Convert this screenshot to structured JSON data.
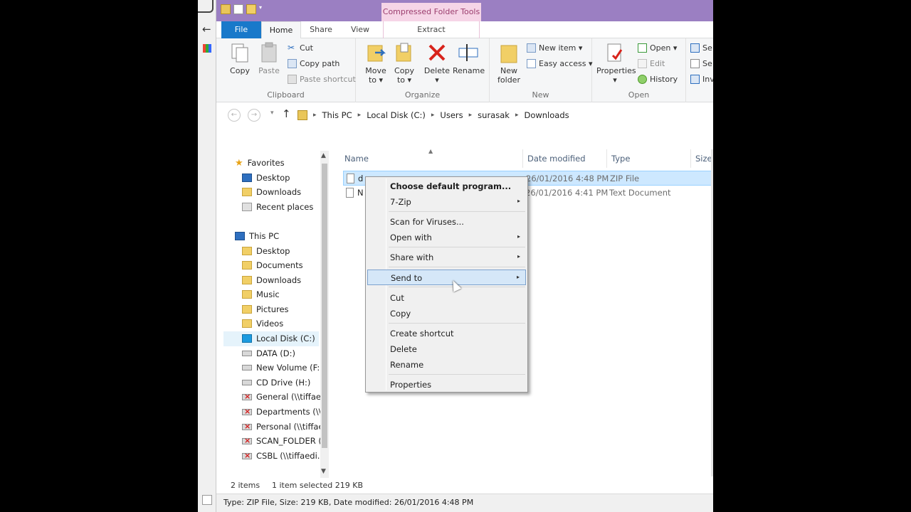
{
  "titlebar": {
    "contextual_tab_group": "Compressed Folder Tools"
  },
  "tabs": {
    "file": "File",
    "home": "Home",
    "share": "Share",
    "view": "View",
    "extract": "Extract"
  },
  "ribbon": {
    "clipboard": {
      "label": "Clipboard",
      "copy": "Copy",
      "paste": "Paste",
      "cut": "Cut",
      "copy_path": "Copy path",
      "paste_shortcut": "Paste shortcut"
    },
    "organize": {
      "label": "Organize",
      "move_to_1": "Move",
      "move_to_2": "to ▾",
      "copy_to_1": "Copy",
      "copy_to_2": "to ▾",
      "delete": "Delete",
      "delete_caret": "▾",
      "rename": "Rename"
    },
    "new": {
      "label": "New",
      "new_folder_1": "New",
      "new_folder_2": "folder",
      "new_item": "New item ▾",
      "easy_access": "Easy access ▾"
    },
    "open": {
      "label": "Open",
      "properties": "Properties",
      "properties_caret": "▾",
      "open": "Open ▾",
      "edit": "Edit",
      "history": "History"
    },
    "select": {
      "item1": "Se",
      "item2": "Se",
      "item3": "Inv"
    }
  },
  "address": {
    "crumbs": [
      "This PC",
      "Local Disk (C:)",
      "Users",
      "surasak",
      "Downloads"
    ]
  },
  "navpane": {
    "favorites": "Favorites",
    "fav_items": [
      "Desktop",
      "Downloads",
      "Recent places"
    ],
    "this_pc": "This PC",
    "pc_items": [
      "Desktop",
      "Documents",
      "Downloads",
      "Music",
      "Pictures",
      "Videos",
      "Local Disk (C:)",
      "DATA (D:)",
      "New Volume (F:)",
      "CD Drive (H:)",
      "General (\\\\tiffaed",
      "Departments (\\\\t",
      "Personal (\\\\tiffae",
      "SCAN_FOLDER (\\",
      "CSBL (\\\\tiffaedi.lo"
    ]
  },
  "filelist": {
    "columns": {
      "name": "Name",
      "date": "Date modified",
      "type": "Type",
      "size": "Size"
    },
    "rows": [
      {
        "name": "d",
        "date": "26/01/2016 4:48 PM",
        "type": "ZIP File"
      },
      {
        "name": "N",
        "date": "26/01/2016 4:41 PM",
        "type": "Text Document"
      }
    ]
  },
  "context_menu": {
    "choose_default": "Choose default program...",
    "seven_zip": "7-Zip",
    "scan": "Scan for Viruses...",
    "open_with": "Open with",
    "share_with": "Share with",
    "send_to": "Send to",
    "cut": "Cut",
    "copy": "Copy",
    "create_shortcut": "Create shortcut",
    "delete": "Delete",
    "rename": "Rename",
    "properties": "Properties",
    "submenu_arrow": "▸"
  },
  "status": {
    "items": "2 items",
    "selected": "1 item selected  219 KB"
  },
  "infobar": {
    "text": "Type: ZIP File, Size: 219 KB, Date modified: 26/01/2016 4:48 PM"
  }
}
